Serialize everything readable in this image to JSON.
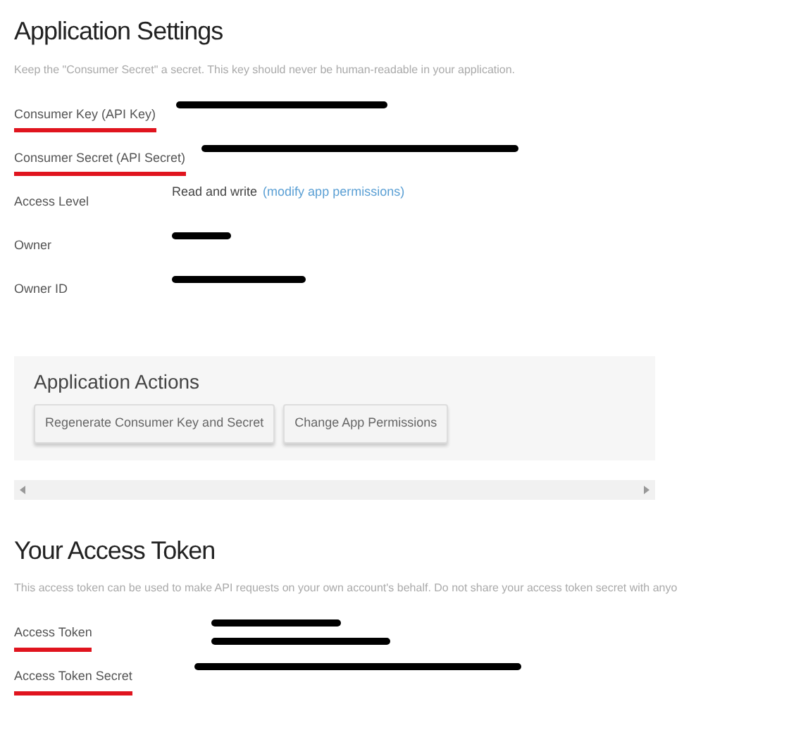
{
  "settings": {
    "title": "Application Settings",
    "description": "Keep the \"Consumer Secret\" a secret. This key should never be human-readable in your application.",
    "fields": [
      {
        "label": "Consumer Key (API Key)",
        "highlighted": true,
        "values": [
          {
            "kind": "redacted"
          }
        ]
      },
      {
        "label": "Consumer Secret (API Secret)",
        "highlighted": true,
        "values": [
          {
            "kind": "redacted"
          }
        ]
      },
      {
        "label": "Access Level",
        "highlighted": false,
        "values": [
          {
            "kind": "text",
            "text": "Read and write"
          },
          {
            "kind": "link",
            "text": "(modify app permissions)"
          }
        ]
      },
      {
        "label": "Owner",
        "highlighted": false,
        "values": [
          {
            "kind": "redacted"
          }
        ]
      },
      {
        "label": "Owner ID",
        "highlighted": false,
        "values": [
          {
            "kind": "redacted"
          }
        ]
      }
    ]
  },
  "actions": {
    "title": "Application Actions",
    "buttons": [
      "Regenerate Consumer Key and Secret",
      "Change App Permissions"
    ]
  },
  "token": {
    "title": "Your Access Token",
    "description": "This access token can be used to make API requests on your own account's behalf. Do not share your access token secret with anyo",
    "fields": [
      {
        "label": "Access Token",
        "highlighted": true,
        "values": [
          {
            "kind": "redacted"
          },
          {
            "kind": "redacted"
          }
        ]
      },
      {
        "label": "Access Token Secret",
        "highlighted": true,
        "values": [
          {
            "kind": "redacted"
          }
        ]
      }
    ]
  }
}
